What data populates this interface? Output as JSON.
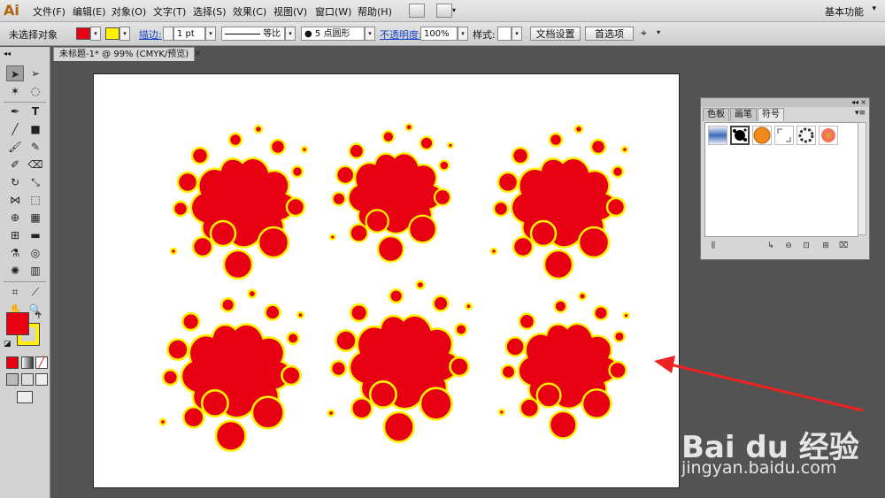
{
  "app": {
    "logo": "Ai",
    "workspace": "基本功能"
  },
  "menu": [
    "文件(F)",
    "编辑(E)",
    "对象(O)",
    "文字(T)",
    "选择(S)",
    "效果(C)",
    "视图(V)",
    "窗口(W)",
    "帮助(H)"
  ],
  "control": {
    "selection": "未选择对象",
    "stroke_label": "描边:",
    "stroke_weight": "1 pt",
    "stroke_profile": "等比",
    "brush": "● 5 点圆形",
    "opacity_label": "不透明度:",
    "opacity": "100%",
    "style_label": "样式:",
    "doc_setup": "文档设置",
    "prefs": "首选项"
  },
  "document_tab": {
    "title": "未标题-1* @ 99% (CMYK/预览)",
    "close": "×"
  },
  "symbols_panel": {
    "tabs": [
      "色板",
      "画笔",
      "符号"
    ],
    "active_tab": 2
  },
  "colors": {
    "fill": "#e60012",
    "stroke": "#fff100",
    "arrow": "#ee2222"
  },
  "icons": {
    "close": "×",
    "chevron": "▾",
    "collapse": "◂◂"
  },
  "watermark": {
    "logo": "Bai du 经验",
    "url": "jingyan.baidu.com"
  }
}
